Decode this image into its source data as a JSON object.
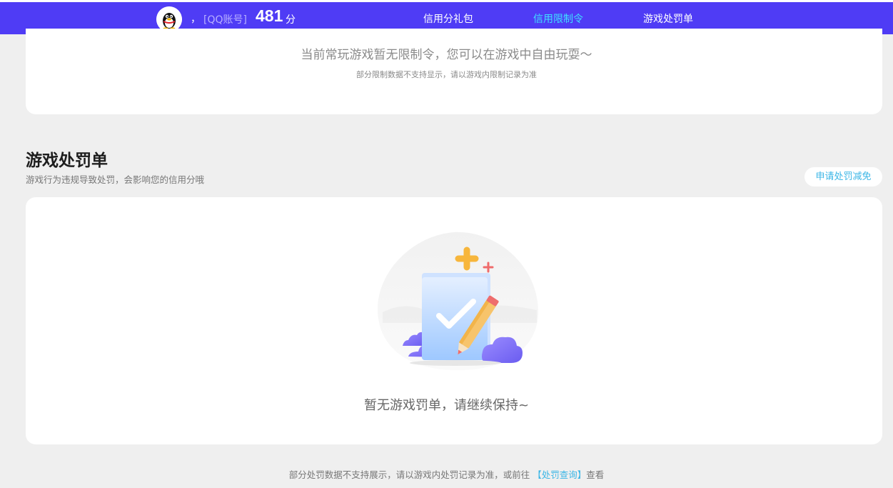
{
  "header": {
    "comma": "，",
    "account_label": "[QQ账号]",
    "score": "481",
    "score_unit": "分",
    "nav": [
      {
        "label": "信用分礼包"
      },
      {
        "label": "信用限制令"
      },
      {
        "label": "游戏处罚单"
      }
    ],
    "active_tab": "信用限制令",
    "colors": {
      "bar": "#4f3cf5",
      "active": "#3fe0ff"
    }
  },
  "restriction": {
    "empty_message": "当前常玩游戏暂无限制令，您可以在游戏中自由玩耍～",
    "note": "部分限制数据不支持显示，请以游戏内限制记录为准"
  },
  "penalty": {
    "title": "游戏处罚单",
    "subtitle": "游戏行为违规导致处罚，会影响您的信用分哦",
    "appeal_button": "申请处罚减免",
    "empty_message": "暂无游戏罚单，请继续保持~",
    "illustration_icon": "folder-check-pencil-icon"
  },
  "footer": {
    "note_prefix": "部分处罚数据不支持展示，请以游戏内处罚记录为准，或前往 ",
    "link": "【处罚查询】",
    "note_suffix": "查看"
  }
}
